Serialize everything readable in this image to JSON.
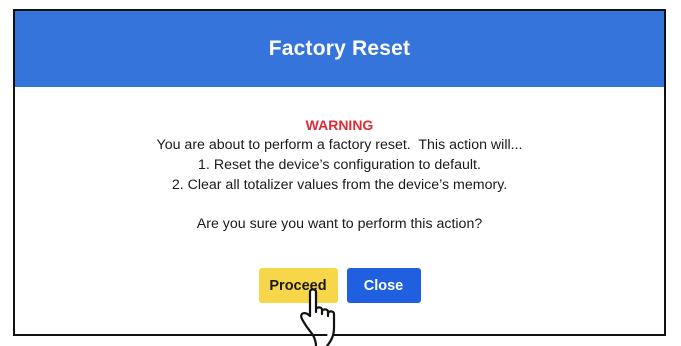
{
  "dialog": {
    "title": "Factory Reset",
    "warning_label": "WARNING",
    "message_lines": [
      "You are about to perform a factory reset.  This action will...",
      "1. Reset the device’s configuration to default.",
      "2. Clear all totalizer values from the device’s memory."
    ],
    "question": "Are you sure you want to perform this action?",
    "buttons": {
      "proceed_label": "Proceed",
      "close_label": "Close"
    }
  },
  "colors": {
    "header_bg": "#3474db",
    "warning_text": "#e02a35",
    "proceed_bg": "#f8d64a",
    "close_bg": "#1f5fe0"
  },
  "cursor": {
    "icon": "hand-pointer-icon"
  }
}
